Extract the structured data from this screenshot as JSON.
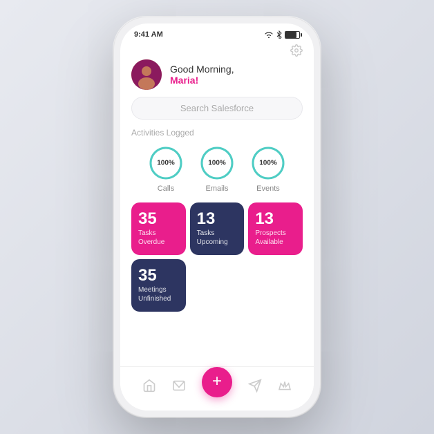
{
  "status_bar": {
    "time": "9:41 AM",
    "wifi": "📶",
    "bluetooth": "🔵",
    "battery": "battery"
  },
  "settings": {
    "icon": "⚙"
  },
  "header": {
    "greeting_line1": "Good Morning,",
    "greeting_name": "Maria!",
    "avatar_emoji": "👩"
  },
  "search": {
    "placeholder": "Search Salesforce"
  },
  "activities": {
    "section_label": "Activities Logged",
    "items": [
      {
        "label": "Calls",
        "percent": "100%",
        "value": 100
      },
      {
        "label": "Emails",
        "percent": "100%",
        "value": 100
      },
      {
        "label": "Events",
        "percent": "100%",
        "value": 100
      }
    ]
  },
  "stats": {
    "cards_row1": [
      {
        "number": "35",
        "label": "Tasks\nOverdue",
        "style": "pink",
        "id": "tasks-overdue"
      },
      {
        "number": "13",
        "label": "Tasks\nUpcoming",
        "style": "dark",
        "id": "tasks-upcoming"
      },
      {
        "number": "13",
        "label": "Prospects\nAvailable",
        "style": "pink",
        "id": "prospects-available"
      }
    ],
    "cards_row2": [
      {
        "number": "35",
        "label": "Meetings\nUnfinished",
        "style": "dark",
        "id": "meetings-unfinished"
      }
    ]
  },
  "nav": {
    "items": [
      {
        "icon": "home",
        "id": "home-nav"
      },
      {
        "icon": "mail",
        "id": "mail-nav"
      },
      {
        "icon": "add",
        "id": "add-nav"
      },
      {
        "icon": "send",
        "id": "send-nav"
      },
      {
        "icon": "star",
        "id": "star-nav"
      }
    ]
  }
}
